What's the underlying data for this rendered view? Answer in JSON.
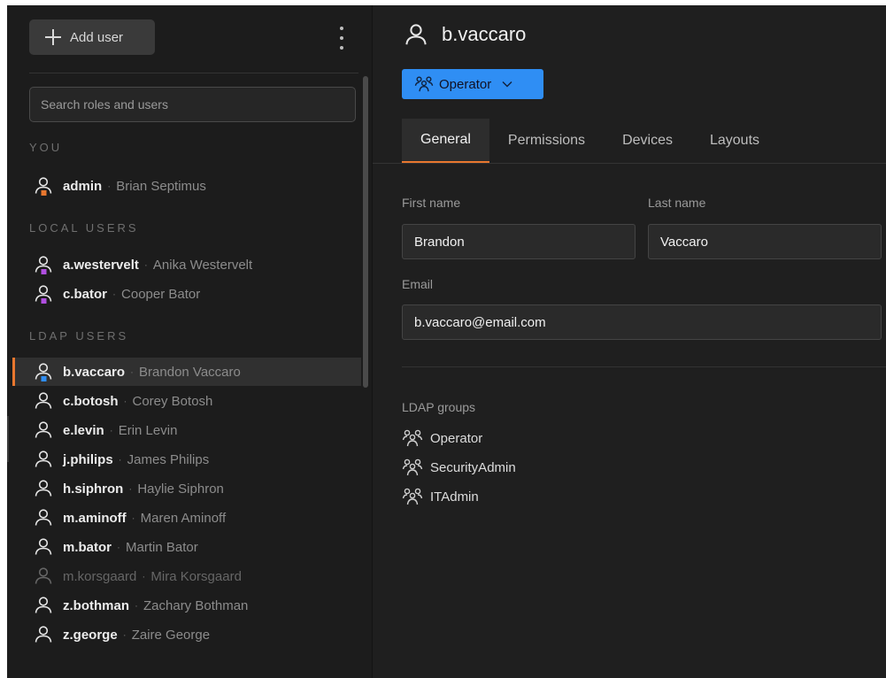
{
  "sidebar": {
    "add_user_label": "Add user",
    "search_placeholder": "Search roles and users",
    "sections": {
      "you": "YOU",
      "local": "LOCAL USERS",
      "ldap": "LDAP USERS"
    },
    "you_users": [
      {
        "login": "admin",
        "name": "Brian Septimus",
        "badge_color": "#e8772e"
      }
    ],
    "local_users": [
      {
        "login": "a.westervelt",
        "name": "Anika Westervelt",
        "badge_color": "#b04fe0"
      },
      {
        "login": "c.bator",
        "name": "Cooper Bator",
        "badge_color": "#b04fe0"
      }
    ],
    "ldap_users": [
      {
        "login": "b.vaccaro",
        "name": "Brandon Vaccaro",
        "badge_color": "#2f8ef4",
        "selected": true
      },
      {
        "login": "c.botosh",
        "name": "Corey Botosh"
      },
      {
        "login": "e.levin",
        "name": "Erin Levin"
      },
      {
        "login": "j.philips",
        "name": "James Philips"
      },
      {
        "login": "h.siphron",
        "name": "Haylie Siphron"
      },
      {
        "login": "m.aminoff",
        "name": "Maren Aminoff"
      },
      {
        "login": "m.bator",
        "name": "Martin Bator"
      },
      {
        "login": "m.korsgaard",
        "name": "Mira Korsgaard",
        "disabled": true
      },
      {
        "login": "z.bothman",
        "name": "Zachary Bothman"
      },
      {
        "login": "z.george",
        "name": "Zaire George"
      }
    ],
    "separator": "·"
  },
  "main": {
    "title": "b.vaccaro",
    "role_label": "Operator",
    "tabs": [
      "General",
      "Permissions",
      "Devices",
      "Layouts"
    ],
    "active_tab": "General",
    "form": {
      "first_name_label": "First name",
      "first_name_value": "Brandon",
      "last_name_label": "Last name",
      "last_name_value": "Vaccaro",
      "email_label": "Email",
      "email_value": "b.vaccaro@email.com"
    },
    "ldap_groups_label": "LDAP groups",
    "ldap_groups": [
      "Operator",
      "SecurityAdmin",
      "ITAdmin"
    ]
  },
  "colors": {
    "accent": "#e8772e",
    "role_button": "#2f8ef4",
    "background": "#1f1f1f",
    "sidebar": "#1c1c1c"
  },
  "icons": {
    "add": "plus-icon",
    "menu": "kebab-menu-icon",
    "user": "user-icon",
    "group": "user-group-icon",
    "dropdown": "chevron-down-icon"
  }
}
